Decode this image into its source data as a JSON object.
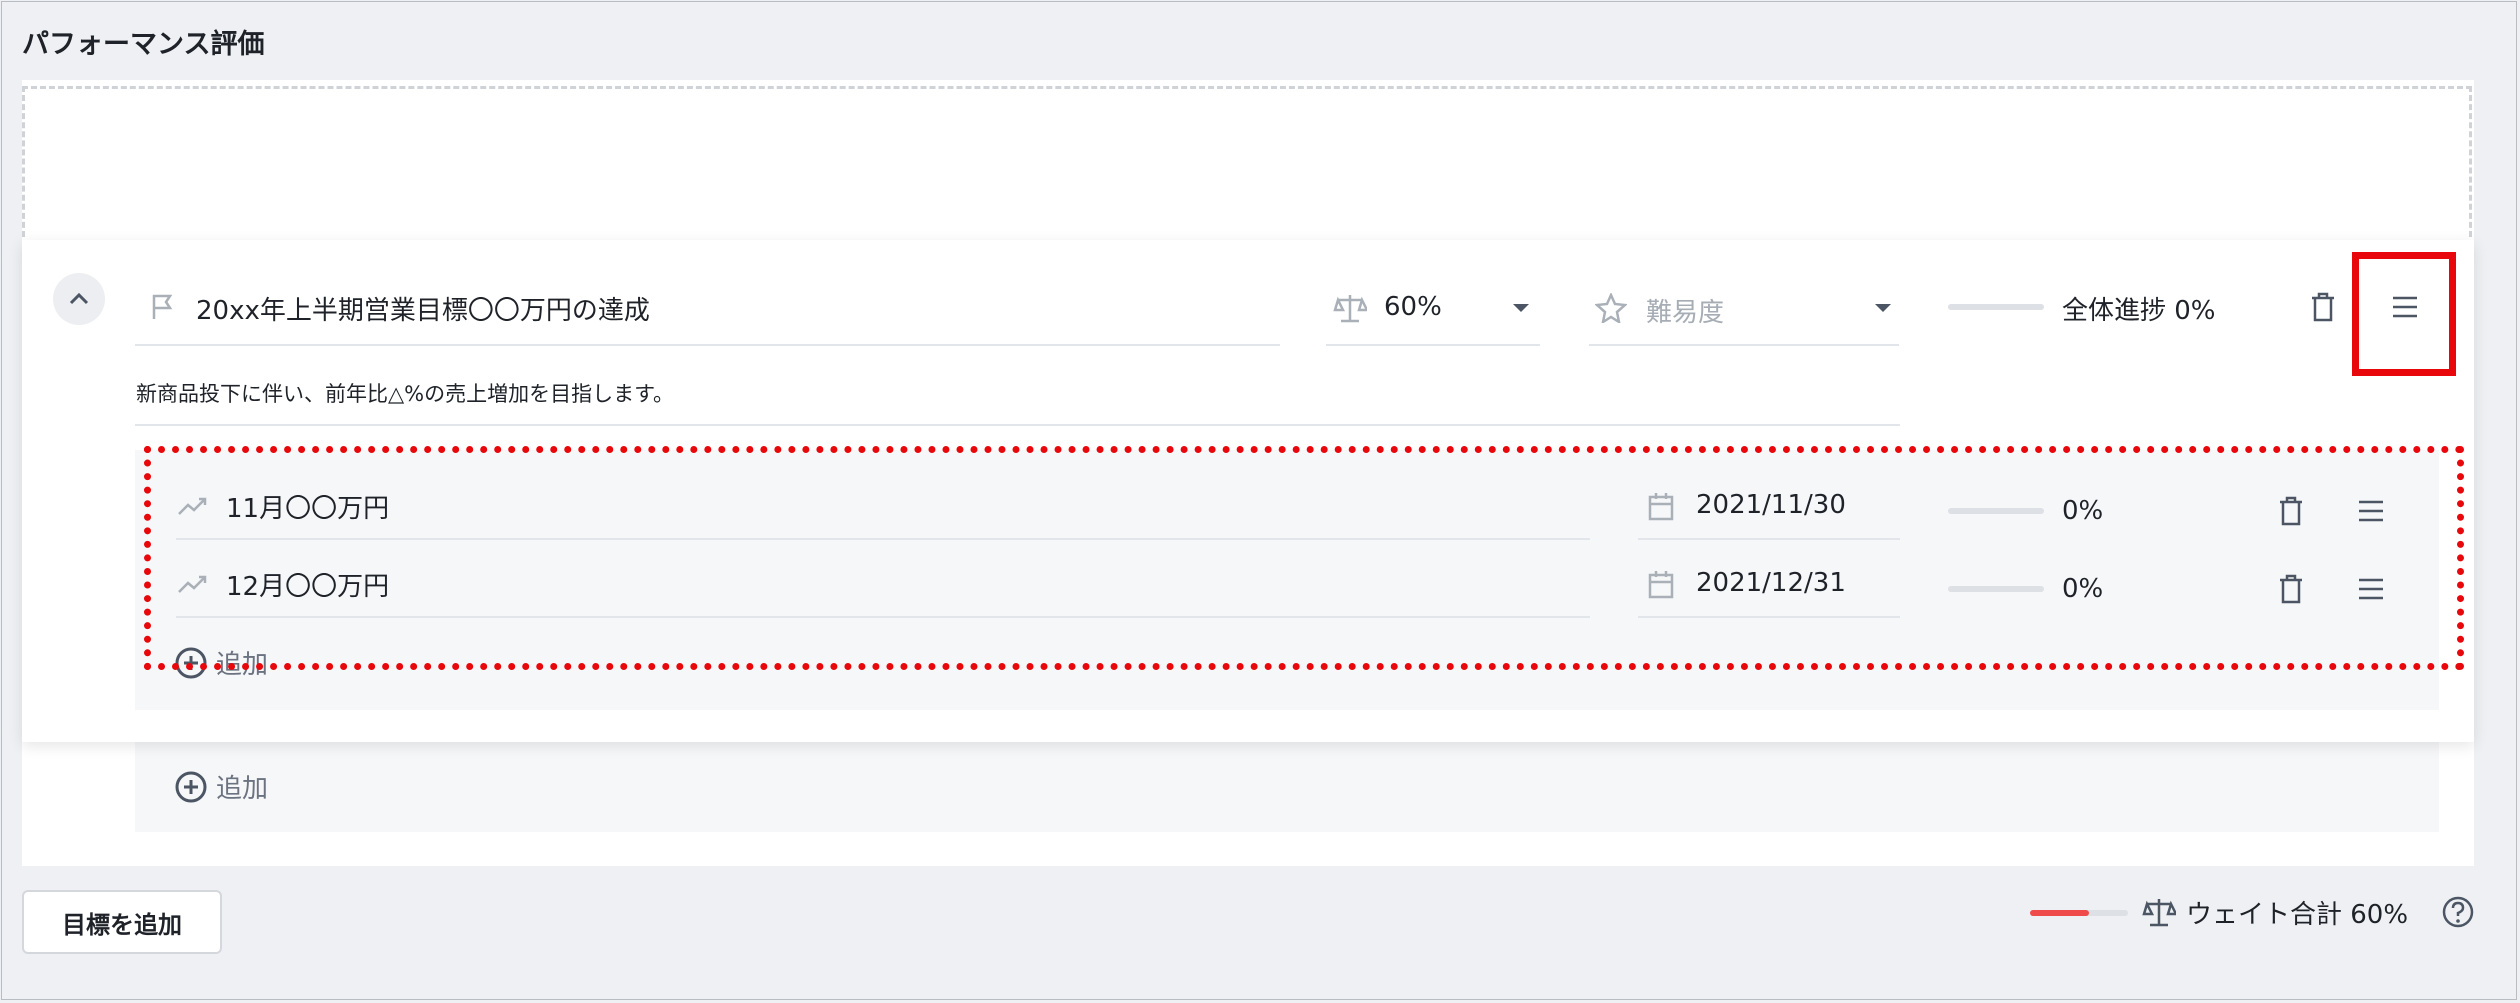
{
  "page": {
    "title": "パフォーマンス評価"
  },
  "goal": {
    "title": "20xx年上半期営業目標〇〇万円の達成",
    "weight": "60%",
    "difficulty_placeholder": "難易度",
    "overall_progress_label": "全体進捗 0%",
    "overall_progress": 0,
    "description": "新商品投下に伴い、前年比△%の売上増加を目指します。"
  },
  "subgoals": [
    {
      "title": "11月〇〇万円",
      "date": "2021/11/30",
      "progress_label": "0%",
      "progress": 0
    },
    {
      "title": "12月〇〇万円",
      "date": "2021/12/31",
      "progress_label": "0%",
      "progress": 0
    }
  ],
  "add_label": "追加",
  "footer": {
    "add_goal_button": "目標を追加",
    "weight_total_label": "ウェイト合計 60%",
    "weight_total": 0.6
  },
  "colors": {
    "highlight": "#e8070a",
    "weight_bar": "#ef4b4b",
    "icon": "#4b5563"
  }
}
